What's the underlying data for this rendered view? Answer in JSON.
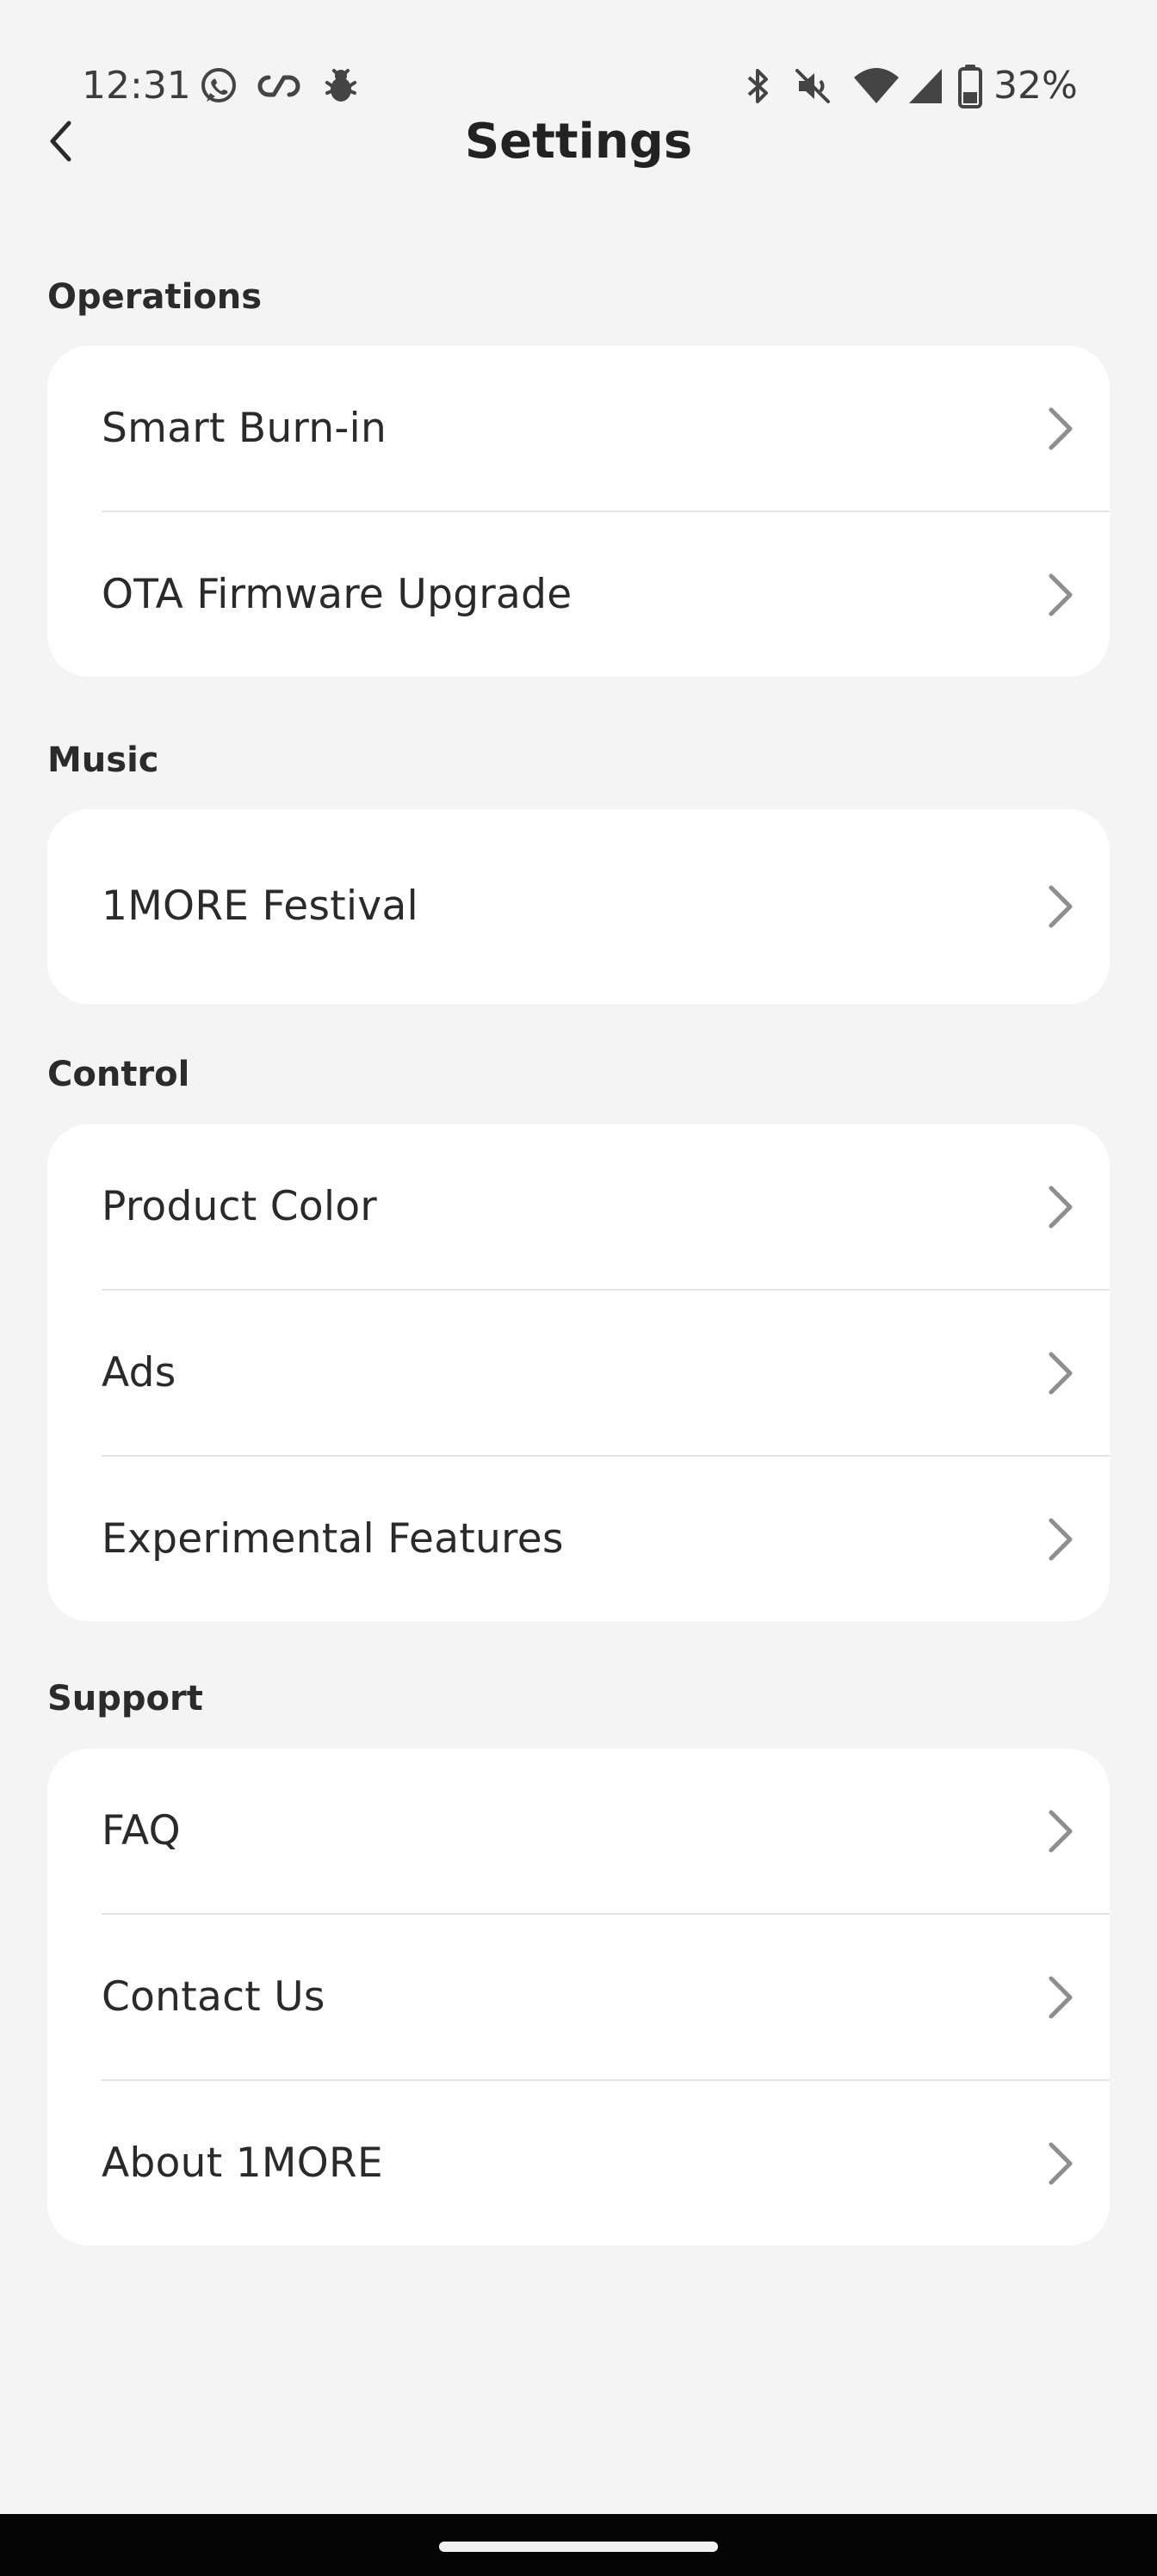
{
  "status_bar": {
    "time": "12:31",
    "battery": "32%",
    "icons": [
      "whatsapp-icon",
      "infinity-link-icon",
      "bug-icon",
      "bluetooth-icon",
      "mute-icon",
      "wifi-icon",
      "cellular-signal-icon",
      "battery-icon"
    ]
  },
  "header": {
    "title": "Settings",
    "back_icon": "chevron-left-icon"
  },
  "sections": {
    "operations": {
      "title": "Operations",
      "items": [
        "Smart Burn-in",
        "OTA Firmware Upgrade"
      ]
    },
    "music": {
      "title": "Music",
      "items": [
        "1MORE Festival"
      ]
    },
    "control": {
      "title": "Control",
      "items": [
        "Product Color",
        "Ads",
        "Experimental Features"
      ]
    },
    "support": {
      "title": "Support",
      "items": [
        "FAQ",
        "Contact Us",
        "About 1MORE"
      ]
    }
  },
  "colors": {
    "background": "#f4f4f4",
    "card": "#ffffff",
    "text": "#2a2a2a",
    "chevron": "#8e8e8e",
    "divider": "#e4e4e4"
  }
}
